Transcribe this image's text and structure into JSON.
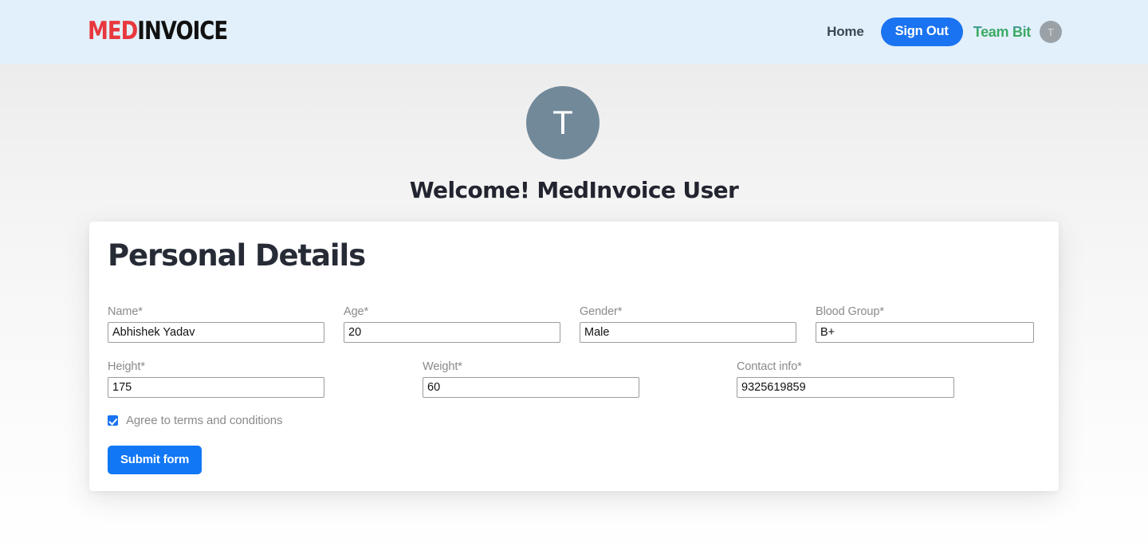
{
  "header": {
    "logo": {
      "part1": "MED",
      "part2": "INVOICE",
      "color1": "#e8383d",
      "color2": "#111111"
    },
    "nav": {
      "home_label": "Home",
      "sign_out_label": "Sign Out",
      "team_name": "Team Bit",
      "avatar_initial": "T"
    },
    "background_color": "#e2f0fb",
    "accent_color": "#1a73f0"
  },
  "hero": {
    "avatar_initial": "T",
    "avatar_color": "#72899a",
    "title": "Welcome! MedInvoice User"
  },
  "form": {
    "card_title": "Personal Details",
    "fields": [
      {
        "label": "Name*",
        "value": "Abhishek Yadav",
        "name": "name"
      },
      {
        "label": "Age*",
        "value": "20",
        "name": "age"
      },
      {
        "label": "Gender*",
        "value": "Male",
        "name": "gender"
      },
      {
        "label": "Blood Group*",
        "value": "B+",
        "name": "blood-group"
      },
      {
        "label": "Height*",
        "value": "175",
        "name": "height"
      },
      {
        "label": "Weight*",
        "value": "60",
        "name": "weight"
      },
      {
        "label": "Contact info*",
        "value": "9325619859",
        "name": "contact-info"
      }
    ],
    "terms": {
      "label": "Agree to terms and conditions",
      "checked": true
    },
    "submit_label": "Submit form",
    "submit_color": "#1177f5"
  }
}
